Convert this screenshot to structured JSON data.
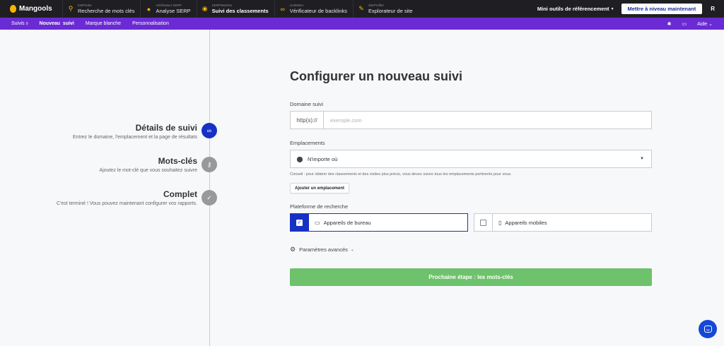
{
  "topbar": {
    "brand": "Mangools",
    "apps": [
      {
        "sub": "KWFinder",
        "name": "Recherche de mots clés",
        "icon": "kwfinder-icon"
      },
      {
        "sub": "Vérificateur SERP",
        "name": "Analyse SERP",
        "icon": "serp-pin-icon"
      },
      {
        "sub": "SERPWatcher",
        "name": "Suivi des classements",
        "icon": "serpwatcher-icon"
      },
      {
        "sub": "LinkMiner",
        "name": "Vérificateur de backlinks",
        "icon": "link-icon"
      },
      {
        "sub": "SiteProfiler",
        "name": "Explorateur de site",
        "icon": "siteprofiler-icon"
      }
    ],
    "mini_tools": "Mini outils de référencement",
    "upgrade": "Mettre à niveau maintenant",
    "avatar": "R"
  },
  "subnav": {
    "tracks": "Suivis",
    "tracks_badge": "0",
    "new_track": "Nouveau  suivi",
    "white_label": "Marque blanche",
    "customization": "Personnalisation",
    "help": "Aide"
  },
  "steps": [
    {
      "title": "Détails de suivi",
      "desc": "Entrez le domaine, l'emplacement et la page de résultats",
      "icon": "link-icon",
      "active": true
    },
    {
      "title": "Mots-clés",
      "desc": "Ajoutez le mot-clé que vous souhaitez suivre",
      "icon": "key-icon",
      "active": false
    },
    {
      "title": "Complet",
      "desc": "C'est terminé ! Vous pouvez maintenant configurer vos rapports.",
      "icon": "check-icon",
      "active": false
    }
  ],
  "form": {
    "title": "Configurer un nouveau suivi",
    "domain_label": "Domaine suivi",
    "domain_prefix": "http(s)://",
    "domain_placeholder": "exemple.com",
    "locations_label": "Emplacements",
    "location_value": "N'importe où",
    "hint": "Conseil : pour obtenir des classements et des visites plus précis, vous devez suivre tous les emplacements pertinents pour vous.",
    "add_location": "Ajouter un emplacement",
    "platform_label": "Plateforme de recherche",
    "desktop": "Appareils de bureau",
    "mobile": "Appareils mobiles",
    "advanced": "Paramètres avancés",
    "next": "Prochaine étape : les mots-clés"
  },
  "colors": {
    "topbar": "#1f1f23",
    "subnav": "#6a2bd4",
    "primary": "#1731c4",
    "next_button": "#6dc26b",
    "inactive_step": "#999999"
  }
}
